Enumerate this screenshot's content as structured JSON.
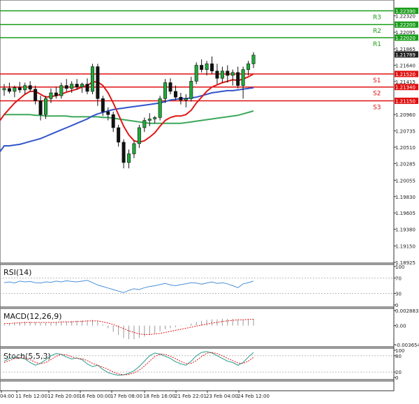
{
  "chart_data": [
    {
      "type": "candlestick",
      "title": "",
      "ylim": [
        1.18925,
        1.225
      ],
      "y_ticks": [
        1.2232,
        1.22095,
        1.21865,
        1.2164,
        1.21415,
        1.2096,
        1.20735,
        1.2051,
        1.20285,
        1.20055,
        1.1983,
        1.19605,
        1.1938,
        1.1915,
        1.18925
      ],
      "levels": [
        {
          "name": "R3",
          "value": 1.2239,
          "label": "1.22390",
          "color": "#1a9e1a"
        },
        {
          "name": "R2",
          "value": 1.222,
          "label": "1.22200",
          "color": "#1a9e1a"
        },
        {
          "name": "R1",
          "value": 1.2202,
          "label": "1.22020",
          "color": "#1a9e1a"
        },
        {
          "name": "S1",
          "value": 1.2152,
          "label": "1.21520",
          "color": "#e01010"
        },
        {
          "name": "S2",
          "value": 1.2134,
          "label": "1.21340",
          "color": "#e01010"
        },
        {
          "name": "S3",
          "value": 1.2115,
          "label": "1.21150",
          "color": "#e01010"
        }
      ],
      "current_price": {
        "value": 1.21789,
        "label": "1.21789"
      },
      "x_ticks": [
        "04:00",
        "11 Feb 12:00",
        "12 Feb 20:00",
        "16 Feb 00:00",
        "17 Feb 08:00",
        "18 Feb 16:00",
        "21 Feb 22:01",
        "23 Feb 04:00",
        "24 Feb 12:00"
      ],
      "candles": [
        [
          1.213,
          1.2138,
          1.2122,
          1.2132
        ],
        [
          1.2132,
          1.214,
          1.2125,
          1.2128
        ],
        [
          1.2128,
          1.2136,
          1.212,
          1.2133
        ],
        [
          1.2133,
          1.2141,
          1.2126,
          1.213
        ],
        [
          1.213,
          1.214,
          1.2124,
          1.2136
        ],
        [
          1.2136,
          1.2142,
          1.2128,
          1.2131
        ],
        [
          1.2131,
          1.2136,
          1.211,
          1.2115
        ],
        [
          1.2115,
          1.2122,
          1.2088,
          1.2096
        ],
        [
          1.2096,
          1.2122,
          1.209,
          1.2118
        ],
        [
          1.2118,
          1.2132,
          1.2112,
          1.2126
        ],
        [
          1.2126,
          1.2134,
          1.2118,
          1.2122
        ],
        [
          1.2122,
          1.214,
          1.2118,
          1.2136
        ],
        [
          1.2136,
          1.2145,
          1.2128,
          1.2132
        ],
        [
          1.2132,
          1.2142,
          1.2126,
          1.2138
        ],
        [
          1.2138,
          1.2145,
          1.213,
          1.2134
        ],
        [
          1.2134,
          1.214,
          1.2126,
          1.2138
        ],
        [
          1.2138,
          1.2146,
          1.2124,
          1.2128
        ],
        [
          1.2128,
          1.2166,
          1.2124,
          1.2162
        ],
        [
          1.2162,
          1.2166,
          1.2108,
          1.2118
        ],
        [
          1.2118,
          1.2122,
          1.2094,
          1.21
        ],
        [
          1.21,
          1.2106,
          1.2088,
          1.2096
        ],
        [
          1.2096,
          1.21,
          1.2072,
          1.2078
        ],
        [
          1.2078,
          1.2082,
          1.2052,
          1.2058
        ],
        [
          1.2058,
          1.2062,
          1.2022,
          1.203
        ],
        [
          1.203,
          1.2048,
          1.2022,
          1.2042
        ],
        [
          1.2042,
          1.206,
          1.2036,
          1.2056
        ],
        [
          1.2056,
          1.2082,
          1.205,
          1.2078
        ],
        [
          1.2078,
          1.2092,
          1.2072,
          1.2088
        ],
        [
          1.2088,
          1.2098,
          1.208,
          1.209
        ],
        [
          1.209,
          1.2094,
          1.2084,
          1.2092
        ],
        [
          1.2092,
          1.2122,
          1.2088,
          1.2118
        ],
        [
          1.2118,
          1.2145,
          1.2112,
          1.214
        ],
        [
          1.214,
          1.2146,
          1.2124,
          1.2128
        ],
        [
          1.2128,
          1.2136,
          1.2116,
          1.212
        ],
        [
          1.212,
          1.2126,
          1.211,
          1.2116
        ],
        [
          1.2116,
          1.2124,
          1.2106,
          1.2118
        ],
        [
          1.2118,
          1.2148,
          1.2114,
          1.2142
        ],
        [
          1.2142,
          1.2168,
          1.2138,
          1.2164
        ],
        [
          1.2164,
          1.2172,
          1.2154,
          1.2158
        ],
        [
          1.2158,
          1.217,
          1.215,
          1.2166
        ],
        [
          1.2166,
          1.2176,
          1.2152,
          1.2156
        ],
        [
          1.2156,
          1.2166,
          1.2138,
          1.2146
        ],
        [
          1.2146,
          1.2162,
          1.214,
          1.2156
        ],
        [
          1.2156,
          1.2164,
          1.214,
          1.215
        ],
        [
          1.215,
          1.2158,
          1.2136,
          1.2154
        ],
        [
          1.2154,
          1.2162,
          1.2132,
          1.2136
        ],
        [
          1.2136,
          1.2162,
          1.2118,
          1.2158
        ],
        [
          1.2158,
          1.217,
          1.215,
          1.2166
        ],
        [
          1.2166,
          1.2182,
          1.216,
          1.2178
        ]
      ],
      "ma_red": [
        1.2096,
        1.2104,
        1.2112,
        1.2118,
        1.2124,
        1.2128,
        1.2128,
        1.2124,
        1.212,
        1.2121,
        1.2122,
        1.2124,
        1.2127,
        1.2129,
        1.2131,
        1.2134,
        1.2136,
        1.2141,
        1.2141,
        1.2136,
        1.2126,
        1.2112,
        1.2096,
        1.208,
        1.2068,
        1.206,
        1.2058,
        1.206,
        1.2065,
        1.2071,
        1.208,
        1.2088,
        1.2092,
        1.2094,
        1.2094,
        1.2096,
        1.2102,
        1.2112,
        1.212,
        1.2128,
        1.2134,
        1.2137,
        1.214,
        1.2142,
        1.2144,
        1.2143,
        1.2145,
        1.2148,
        1.2152
      ],
      "ma_blue": [
        1.2053,
        1.2053,
        1.2054,
        1.2055,
        1.2057,
        1.2059,
        1.2061,
        1.2063,
        1.2066,
        1.2069,
        1.2072,
        1.2075,
        1.2078,
        1.2081,
        1.2084,
        1.2087,
        1.209,
        1.2094,
        1.2097,
        1.2099,
        1.2101,
        1.2103,
        1.2104,
        1.2105,
        1.2106,
        1.2107,
        1.2108,
        1.2109,
        1.211,
        1.2111,
        1.2112,
        1.2114,
        1.2116,
        1.2117,
        1.2118,
        1.2118,
        1.2119,
        1.212,
        1.2122,
        1.2124,
        1.2126,
        1.2127,
        1.2128,
        1.2129,
        1.2129,
        1.213,
        1.2131,
        1.2132,
        1.2133
      ],
      "ma_green": [
        1.2096,
        1.2096,
        1.2096,
        1.2096,
        1.2096,
        1.2096,
        1.2095,
        1.2095,
        1.2094,
        1.2094,
        1.2094,
        1.2094,
        1.2094,
        1.2093,
        1.2093,
        1.2093,
        1.2093,
        1.2093,
        1.2093,
        1.2092,
        1.2092,
        1.2091,
        1.209,
        1.2089,
        1.2088,
        1.2087,
        1.2086,
        1.2085,
        1.2084,
        1.2084,
        1.2084,
        1.2084,
        1.2084,
        1.2084,
        1.2084,
        1.2085,
        1.2086,
        1.2087,
        1.2088,
        1.2089,
        1.209,
        1.2091,
        1.2092,
        1.2093,
        1.2094,
        1.2095,
        1.2097,
        1.2099,
        1.2101
      ]
    },
    {
      "type": "line",
      "title": "RSI(14)",
      "ylim": [
        0,
        100
      ],
      "y_ticks": [
        100,
        70,
        30,
        0
      ],
      "series": [
        {
          "values": [
            58,
            60,
            57,
            62,
            60,
            61,
            58,
            57,
            60,
            59,
            62,
            60,
            63,
            61,
            60,
            62,
            64,
            58,
            52,
            48,
            44,
            40,
            36,
            32,
            38,
            42,
            40,
            45,
            48,
            50,
            53,
            56,
            52,
            50,
            53,
            55,
            58,
            57,
            54,
            57,
            60,
            56,
            58,
            55,
            50,
            45,
            55,
            58,
            62
          ]
        }
      ]
    },
    {
      "type": "bar",
      "title": "MACD(12,26,9)",
      "ylim": [
        -0.003654,
        0.002883
      ],
      "y_ticks": [
        0.002883,
        0.0,
        -0.003654
      ],
      "histogram": [
        0.0003,
        0.0004,
        0.0005,
        0.0006,
        0.0007,
        0.0007,
        0.0006,
        0.0005,
        0.0005,
        0.0006,
        0.0007,
        0.0008,
        0.0008,
        0.0009,
        0.0009,
        0.001,
        0.001,
        0.0011,
        0.0008,
        0.0002,
        -0.0005,
        -0.0012,
        -0.0018,
        -0.0024,
        -0.0026,
        -0.0026,
        -0.0024,
        -0.0021,
        -0.0018,
        -0.0015,
        -0.0011,
        -0.0007,
        -0.0005,
        -0.0003,
        -0.0001,
        0.0001,
        0.0004,
        0.0007,
        0.0009,
        0.0011,
        0.0012,
        0.0012,
        0.0013,
        0.0013,
        0.0013,
        0.0012,
        0.0012,
        0.0012,
        0.0013
      ],
      "signal": [
        0.0004,
        0.0004,
        0.0005,
        0.0005,
        0.0006,
        0.0006,
        0.0006,
        0.0006,
        0.0006,
        0.0006,
        0.0006,
        0.0007,
        0.0007,
        0.0007,
        0.0008,
        0.0008,
        0.0009,
        0.0009,
        0.0009,
        0.0007,
        0.0005,
        0.0002,
        -0.0002,
        -0.0006,
        -0.001,
        -0.0013,
        -0.0016,
        -0.0017,
        -0.0017,
        -0.0016,
        -0.0015,
        -0.0013,
        -0.0011,
        -0.0009,
        -0.0007,
        -0.0005,
        -0.0003,
        -0.0001,
        0.0001,
        0.0003,
        0.0005,
        0.0006,
        0.0008,
        0.0009,
        0.001,
        0.0011,
        0.0011,
        0.0012,
        0.0012
      ]
    },
    {
      "type": "line",
      "title": "Stoch(5,5,3)",
      "ylim": [
        0,
        100
      ],
      "y_ticks": [
        100,
        80,
        20,
        0
      ],
      "series": [
        {
          "values": [
            60,
            70,
            75,
            72,
            68,
            55,
            45,
            52,
            65,
            80,
            88,
            85,
            75,
            68,
            72,
            65,
            50,
            40,
            45,
            30,
            18,
            12,
            8,
            10,
            15,
            25,
            40,
            60,
            80,
            90,
            86,
            78,
            70,
            58,
            50,
            45,
            60,
            80,
            92,
            95,
            90,
            80,
            70,
            60,
            55,
            45,
            55,
            75,
            92
          ]
        },
        {
          "values": [
            55,
            62,
            70,
            73,
            71,
            65,
            56,
            50,
            55,
            66,
            78,
            85,
            83,
            76,
            70,
            69,
            62,
            52,
            45,
            38,
            30,
            20,
            13,
            10,
            11,
            17,
            27,
            42,
            60,
            77,
            86,
            85,
            78,
            69,
            59,
            51,
            52,
            62,
            77,
            89,
            92,
            88,
            80,
            70,
            62,
            53,
            52,
            60,
            74
          ]
        }
      ]
    }
  ]
}
